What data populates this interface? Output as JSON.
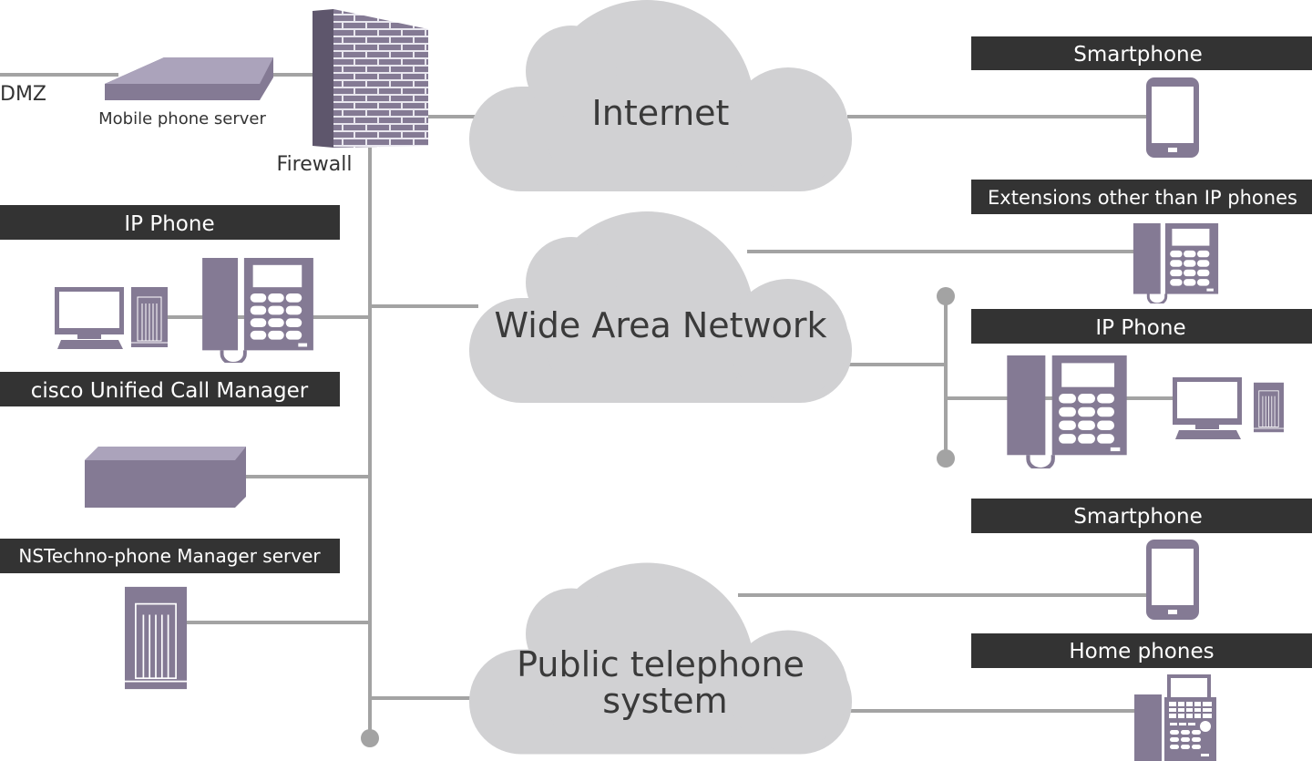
{
  "colors": {
    "icon": "#847a94",
    "line": "#a3a3a3",
    "cloud": "#d1d1d3",
    "label_bar": "#333333",
    "label_text": "#ffffff"
  },
  "left": {
    "dmz": "DMZ",
    "mobile_server": "Mobile phone server",
    "firewall": "Firewall",
    "ip_phone": "IP Phone",
    "call_manager": "cisco Unified Call Manager",
    "nstechno": "NSTechno-phone Manager server"
  },
  "clouds": {
    "internet": "Internet",
    "wan": "Wide Area Network",
    "pstn_line1": "Public telephone",
    "pstn_line2": "system"
  },
  "right": {
    "smartphone_top": "Smartphone",
    "extensions": "Extensions other than IP phones",
    "ip_phone": "IP Phone",
    "smartphone_bottom": "Smartphone",
    "home_phones": "Home phones"
  },
  "icons": [
    "server-icon",
    "firewall-icon",
    "monitor-icon",
    "tower-pc-icon",
    "desk-phone-icon",
    "smartphone-icon",
    "fax-phone-icon",
    "cloud-icon"
  ]
}
